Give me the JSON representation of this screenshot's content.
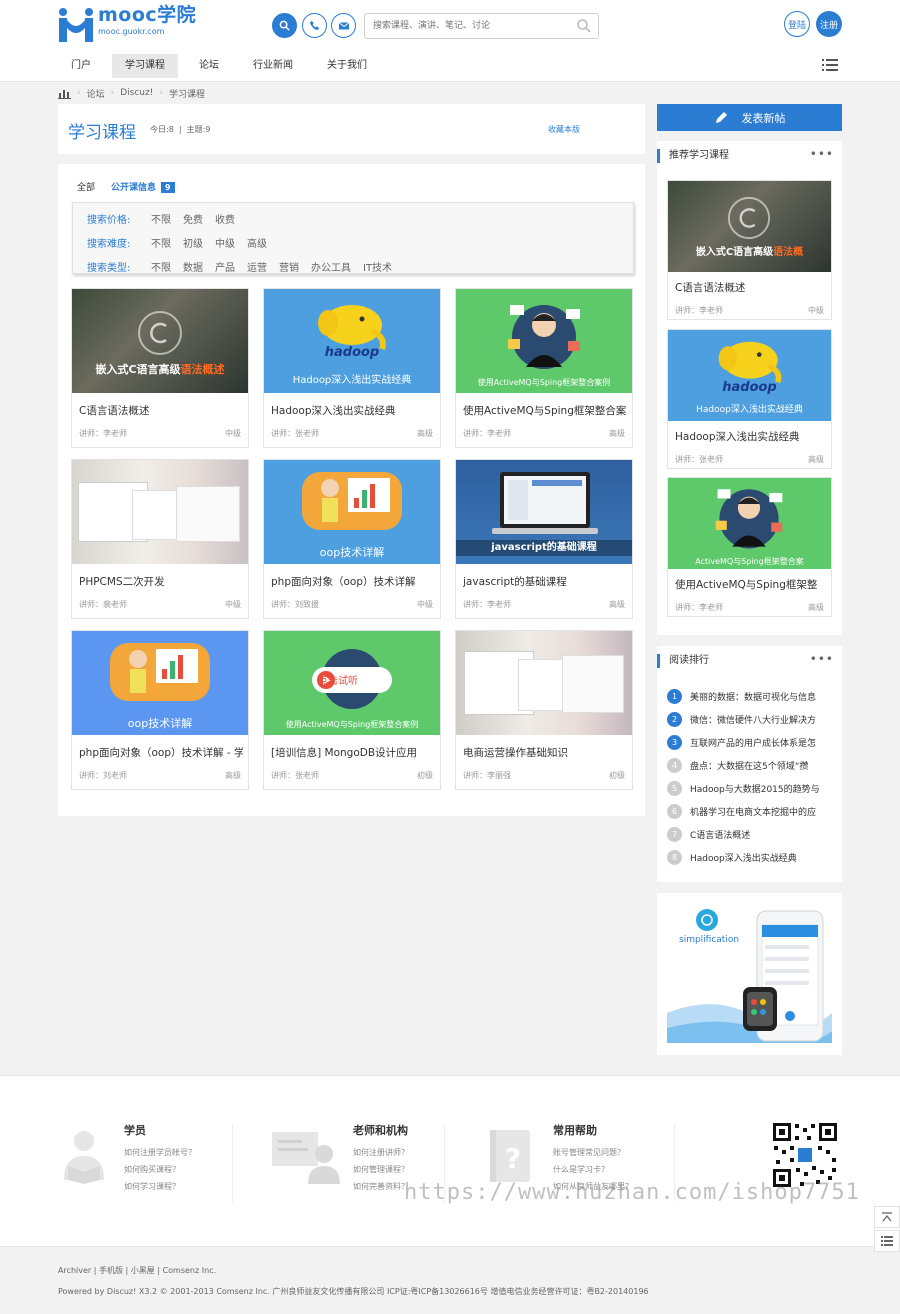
{
  "header": {
    "logo_name": "mooc学院",
    "logo_sub": "mooc.guokr.com",
    "search_placeholder": "搜索课程、演讲、笔记、讨论",
    "login_label": "登陆",
    "register_label": "注册"
  },
  "nav": {
    "items": [
      {
        "label": "门户"
      },
      {
        "label": "学习课程"
      },
      {
        "label": "论坛"
      },
      {
        "label": "行业新闻"
      },
      {
        "label": "关于我们"
      }
    ]
  },
  "breadcrumb": [
    "论坛",
    "Discuz!",
    "学习课程"
  ],
  "forum_head": {
    "title": "学习课程",
    "today": "今日:8",
    "topics": "主题:9",
    "favorite": "收藏本版"
  },
  "tabs": {
    "all": "全部",
    "open": "公开课信息",
    "open_count": "9"
  },
  "filters": {
    "price": {
      "label": "搜索价格:",
      "options": [
        "不限",
        "免费",
        "收费"
      ]
    },
    "difficulty": {
      "label": "搜索难度:",
      "options": [
        "不限",
        "初级",
        "中级",
        "高级"
      ]
    },
    "type": {
      "label": "搜索类型:",
      "options": [
        "不限",
        "数据",
        "产品",
        "运营",
        "营销",
        "办公工具",
        "IT技术"
      ]
    }
  },
  "courses": [
    {
      "title": "C语言语法概述",
      "teacher": "讲师：李老师",
      "level": "中级",
      "thumb_caption": "嵌入式C语言高级语法概述",
      "thumb_caption_hl": "语法概述"
    },
    {
      "title": "Hadoop深入浅出实战经典",
      "teacher": "讲师：张老师",
      "level": "高级",
      "thumb_caption": "Hadoop深入浅出实战经典",
      "thumb_word": "hadoop"
    },
    {
      "title": "使用ActiveMQ与Sping框架整合案",
      "teacher": "讲师：李老师",
      "level": "高级",
      "thumb_caption": "使用ActiveMQ与Sping框架整合案例"
    },
    {
      "title": "PHPCMS二次开发",
      "teacher": "讲师：裴老师",
      "level": "中级"
    },
    {
      "title": "php面向对象（oop）技术详解",
      "teacher": "讲师：刘致援",
      "level": "中级",
      "thumb_caption": "oop技术详解"
    },
    {
      "title": "javascript的基础课程",
      "teacher": "讲师：李老师",
      "level": "高级",
      "thumb_caption": "javascript的基础课程"
    },
    {
      "title": "php面向对象（oop）技术详解 - 学",
      "teacher": "讲师：刘老师",
      "level": "高级",
      "thumb_caption": "oop技术详解"
    },
    {
      "title": "[培训信息] MongoDB设计应用",
      "teacher": "讲师：张老师",
      "level": "初级",
      "thumb_caption": "使用ActiveMQ与Sping框架整合案例",
      "thumb_play": "点击试听"
    },
    {
      "title": "电商运营操作基础知识",
      "teacher": "讲师：李丽强",
      "level": "初级"
    }
  ],
  "sidebar": {
    "post_button": "发表新帖",
    "recommend": {
      "title": "推荐学习课程",
      "more": "•••",
      "items": [
        {
          "title": "C语言语法概述",
          "teacher": "讲师：李老师",
          "level": "中级",
          "thumb_caption": "嵌入式C语言高级语法概",
          "thumb_caption_hl": "语法概"
        },
        {
          "title": "Hadoop深入浅出实战经典",
          "teacher": "讲师：张老师",
          "level": "高级",
          "thumb_caption": "Hadoop深入浅出实战经典",
          "thumb_word": "hadoop"
        },
        {
          "title": "使用ActiveMQ与Sping框架整",
          "teacher": "讲师：李老师",
          "level": "高级",
          "thumb_caption": "ActiveMQ与Sping框架整合案"
        }
      ]
    },
    "ranking": {
      "title": "阅读排行",
      "more": "•••",
      "items": [
        {
          "num": "1",
          "text": "美丽的数据：数据可视化与信息"
        },
        {
          "num": "2",
          "text": "微信：微信硬件八大行业解决方"
        },
        {
          "num": "3",
          "text": "互联网产品的用户成长体系是怎"
        },
        {
          "num": "4",
          "text": "盘点：大数据在这5个领域“攒"
        },
        {
          "num": "5",
          "text": "Hadoop与大数据2015的趋势与"
        },
        {
          "num": "6",
          "text": "机器学习在电商文本挖掘中的应"
        },
        {
          "num": "7",
          "text": "C语言语法概述"
        },
        {
          "num": "8",
          "text": "Hadoop深入浅出实战经典"
        }
      ]
    },
    "app_banner": {
      "caption": "simplification"
    }
  },
  "footer": {
    "columns": [
      {
        "title": "学员",
        "links": [
          "如何注册学员帐号？",
          "如何购买课程？",
          "如何学习课程？"
        ]
      },
      {
        "title": "老师和机构",
        "links": [
          "如何注册讲师？",
          "如何管理课程？",
          "如何完善资料？"
        ]
      },
      {
        "title": "常用帮助",
        "links": [
          "账号管理常见问题？",
          "什么是学习卡？",
          "如何从良师益友哪里？"
        ]
      }
    ],
    "watermark": "https://www.huzhan.com/ishop7751",
    "bottom_links": "Archiver | 手机版 | 小黑屋 | Comsenz Inc.",
    "copyright": "Powered by Discuz! X3.2  © 2001-2013 Comsenz Inc.  广州良师益友文化传播有限公司 ICP证:粤ICP备13026616号 增值电信业务经营许可证：粤B2-20140196"
  },
  "colors": {
    "accent": "#2b7cd3",
    "rank_hot": "#2b7cd3",
    "rank_cold": "#cccccc"
  }
}
